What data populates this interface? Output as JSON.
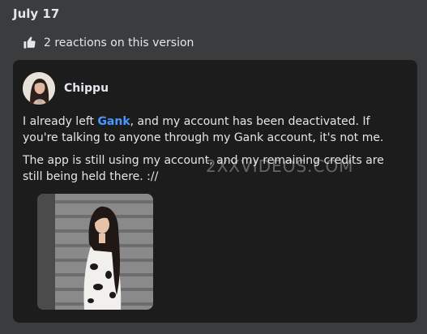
{
  "date_heading": "July 17",
  "reactions": {
    "text": "2 reactions on this version",
    "icon": "thumbs-up-icon"
  },
  "post": {
    "author": "Chippu",
    "paragraph1": {
      "before": "I already left ",
      "mention": "Gank",
      "after": ", and my account has been deactivated. If you're talking to anyone through my Gank account, it's not me."
    },
    "paragraph2": "The app is still using my account, and my remaining credits are still being held there. ://"
  },
  "watermark": "2XXVIDEOS.COM",
  "colors": {
    "page_bg": "#3b3c3d",
    "card_bg": "#1c1c1d",
    "text": "#e4e6eb",
    "mention": "#4599ff"
  }
}
